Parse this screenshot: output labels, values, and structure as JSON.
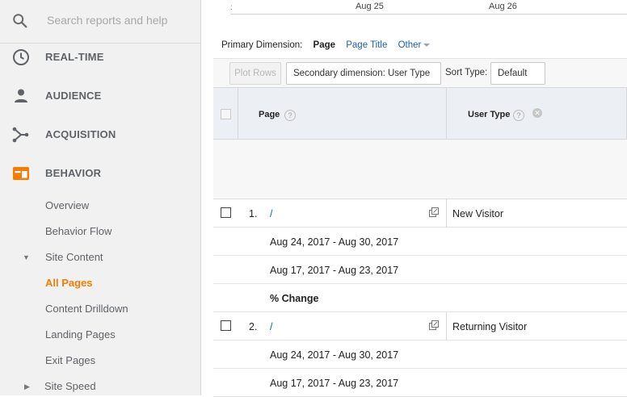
{
  "sidebar": {
    "search_placeholder": "Search reports and help",
    "nav": [
      {
        "label": "REAL-TIME",
        "icon": "clock-icon"
      },
      {
        "label": "AUDIENCE",
        "icon": "person-icon"
      },
      {
        "label": "ACQUISITION",
        "icon": "acquisition-icon"
      },
      {
        "label": "BEHAVIOR",
        "icon": "behavior-icon"
      }
    ],
    "behavior_items": {
      "overview": "Overview",
      "behavior_flow": "Behavior Flow",
      "site_content": "Site Content",
      "all_pages": "All Pages",
      "content_drilldown": "Content Drilldown",
      "landing_pages": "Landing Pages",
      "exit_pages": "Exit Pages",
      "site_speed": "Site Speed"
    },
    "accent_color": "#f57c00"
  },
  "chart": {
    "x_ticks": [
      "Aug 25",
      "Aug 26"
    ]
  },
  "dimension": {
    "label": "Primary Dimension:",
    "active": "Page",
    "options": [
      "Page Title",
      "Other"
    ]
  },
  "toolbar": {
    "plot_rows": "Plot Rows",
    "secondary_dimension": "Secondary dimension: User Type",
    "sort_type_label": "Sort Type:",
    "sort_type_value": "Default"
  },
  "table": {
    "headers": {
      "page": "Page",
      "user_type": "User Type"
    },
    "help_glyph": "?",
    "remove_glyph": "✕",
    "rows": [
      {
        "num": "1.",
        "page": "/",
        "user_type": "New Visitor",
        "sub": [
          "Aug 24, 2017 - Aug 30, 2017",
          "Aug 17, 2017 - Aug 23, 2017",
          "% Change"
        ]
      },
      {
        "num": "2.",
        "page": "/",
        "user_type": "Returning Visitor",
        "sub": [
          "Aug 24, 2017 - Aug 30, 2017",
          "Aug 17, 2017 - Aug 23, 2017"
        ]
      }
    ]
  }
}
